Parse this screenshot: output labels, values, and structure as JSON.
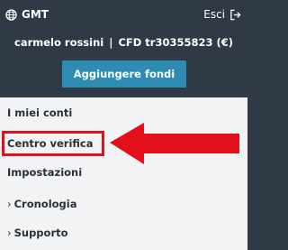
{
  "header": {
    "timezone_label": "GMT",
    "timezone_icon": "globe-icon",
    "logout_label": "Esci",
    "logout_icon": "logout-icon"
  },
  "account": {
    "user_name": "carmelo rossini",
    "separator": "|",
    "account_id": "CFD tr30355823 (€)"
  },
  "actions": {
    "add_funds_label": "Aggiungere fondi"
  },
  "menu": {
    "items": [
      {
        "label": "I miei conti",
        "chevron": ""
      },
      {
        "label": "Centro verifica",
        "chevron": ""
      },
      {
        "label": "Impostazioni",
        "chevron": ""
      },
      {
        "label": "Cronologia",
        "chevron": "›"
      },
      {
        "label": "Supporto",
        "chevron": "›"
      }
    ]
  },
  "annotation": {
    "highlighted_item": "Centro verifica",
    "color": "#e2101b"
  },
  "colors": {
    "header_bg": "#2f3a46",
    "button_bg": "#2d8bb4",
    "menu_bg": "#f2f3f5",
    "menu_text": "#2b2f36"
  }
}
